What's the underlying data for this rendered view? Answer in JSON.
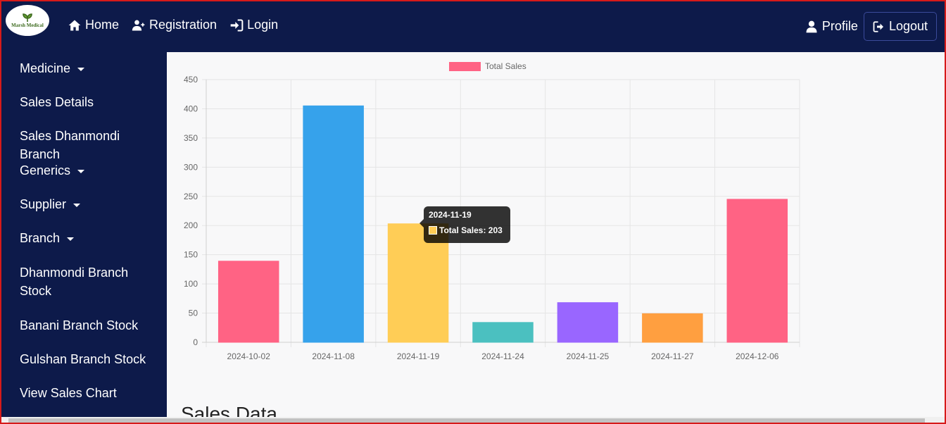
{
  "navbar": {
    "logo_text": "Marsh Medical",
    "home": "Home",
    "registration": "Registration",
    "login": "Login",
    "profile": "Profile",
    "logout": "Logout"
  },
  "sidebar": {
    "items": [
      {
        "label": "Medicine",
        "dropdown": true
      },
      {
        "label": "Sales Details",
        "dropdown": false
      },
      {
        "label": "Sales Dhanmondi Branch",
        "dropdown": false
      },
      {
        "label": "Generics",
        "dropdown": true
      },
      {
        "label": "Supplier",
        "dropdown": true
      },
      {
        "label": "Branch",
        "dropdown": true
      },
      {
        "label": "Dhanmondi Branch Stock",
        "dropdown": false
      },
      {
        "label": "Banani Branch Stock",
        "dropdown": false
      },
      {
        "label": "Gulshan Branch Stock",
        "dropdown": false
      },
      {
        "label": "View Sales Chart",
        "dropdown": false
      }
    ]
  },
  "chart_data": {
    "type": "bar",
    "categories": [
      "2024-10-02",
      "2024-11-08",
      "2024-11-19",
      "2024-11-24",
      "2024-11-25",
      "2024-11-27",
      "2024-12-06"
    ],
    "series": [
      {
        "name": "Total Sales",
        "values": [
          139,
          405,
          203,
          34,
          68,
          49,
          245
        ]
      }
    ],
    "colors": [
      "#ff6384",
      "#36a2eb",
      "#ffcd56",
      "#4bc0c0",
      "#9966ff",
      "#ff9f40",
      "#ff6384"
    ],
    "legend_color": "#ff6384",
    "ylim": [
      0,
      450
    ],
    "yticks": [
      0,
      50,
      100,
      150,
      200,
      250,
      300,
      350,
      400,
      450
    ],
    "grid": true,
    "legend": "top"
  },
  "tooltip": {
    "title": "2024-11-19",
    "body": "Total Sales: 203"
  },
  "section": {
    "title": "Sales Data"
  }
}
